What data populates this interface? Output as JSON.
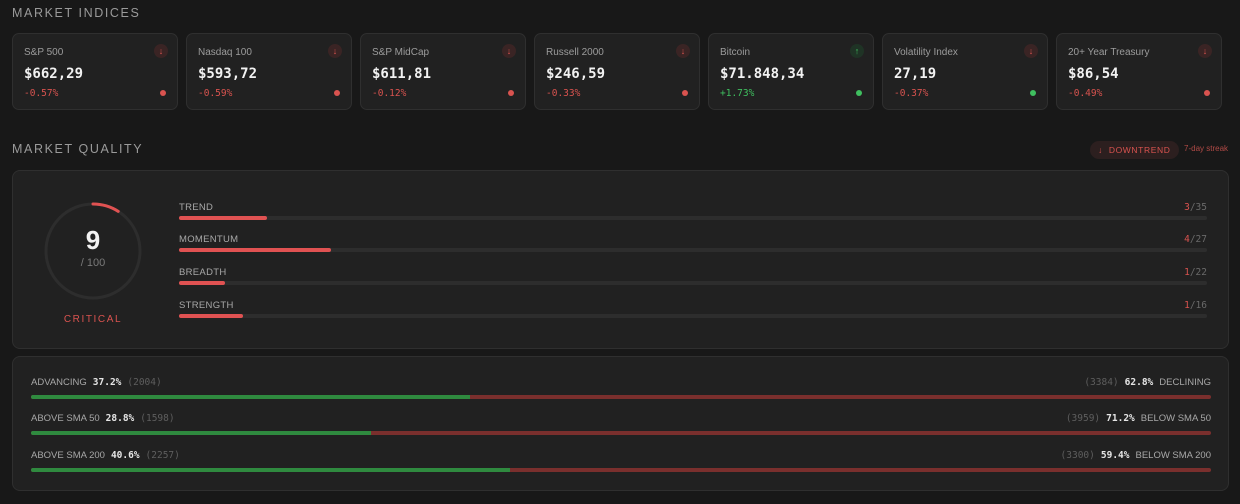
{
  "indices_title": "MARKET INDICES",
  "indices": [
    {
      "name": "S&P 500",
      "value": "$662,29",
      "change": "-0.57%",
      "direction": "down"
    },
    {
      "name": "Nasdaq 100",
      "value": "$593,72",
      "change": "-0.59%",
      "direction": "down"
    },
    {
      "name": "S&P MidCap",
      "value": "$611,81",
      "change": "-0.12%",
      "direction": "down"
    },
    {
      "name": "Russell 2000",
      "value": "$246,59",
      "change": "-0.33%",
      "direction": "down"
    },
    {
      "name": "Bitcoin",
      "value": "$71.848,34",
      "change": "+1.73%",
      "direction": "up"
    },
    {
      "name": "Volatility Index",
      "value": "27,19",
      "change": "-0.37%",
      "direction": "down",
      "dot": "up"
    },
    {
      "name": "20+ Year Treasury",
      "value": "$86,54",
      "change": "-0.49%",
      "direction": "down"
    }
  ],
  "quality_title": "MARKET QUALITY",
  "trend_badge": {
    "icon": "arrow-down-icon",
    "label": "DOWNTREND",
    "streak": "7-day streak"
  },
  "gauge": {
    "score": "9",
    "max": "/ 100",
    "label": "CRITICAL",
    "fraction": 0.09
  },
  "metrics": [
    {
      "name": "TREND",
      "score": "3",
      "max": "/35",
      "fraction": 0.0857
    },
    {
      "name": "MOMENTUM",
      "score": "4",
      "max": "/27",
      "fraction": 0.148
    },
    {
      "name": "BREADTH",
      "score": "1",
      "max": "/22",
      "fraction": 0.045
    },
    {
      "name": "STRENGTH",
      "score": "1",
      "max": "/16",
      "fraction": 0.0625
    }
  ],
  "breadth": [
    {
      "left_label": "ADVANCING",
      "left_pct": "37.2%",
      "left_count": "(2004)",
      "right_count": "(3384)",
      "right_pct": "62.8%",
      "right_label": "DECLINING",
      "fraction": 0.372
    },
    {
      "left_label": "ABOVE  SMA 50",
      "left_pct": "28.8%",
      "left_count": "(1598)",
      "right_count": "(3959)",
      "right_pct": "71.2%",
      "right_label": "BELOW  SMA 50",
      "fraction": 0.288
    },
    {
      "left_label": "ABOVE  SMA 200",
      "left_pct": "40.6%",
      "left_count": "(2257)",
      "right_count": "(3300)",
      "right_pct": "59.4%",
      "right_label": "BELOW  SMA 200",
      "fraction": 0.406
    }
  ],
  "colors": {
    "negative": "#d9534f",
    "positive": "#3fbf5f",
    "gauge_track": "#2d2d2d"
  }
}
